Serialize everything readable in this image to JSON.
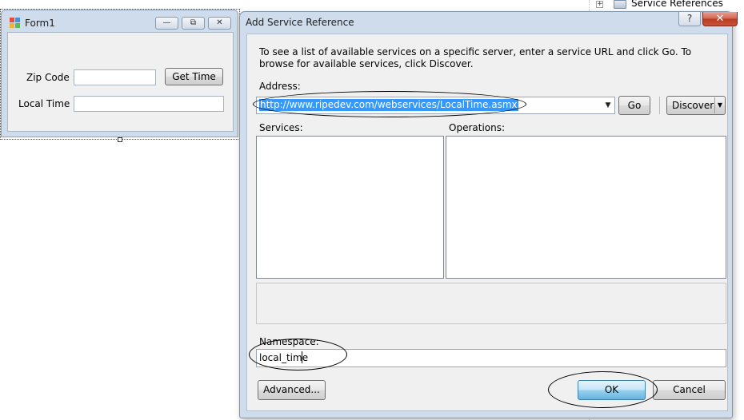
{
  "solution_explorer": {
    "node_label": "Service References",
    "expander": "+"
  },
  "form1": {
    "title": "Form1",
    "zip_label": "Zip Code :",
    "zip_value": "",
    "get_time_label": "Get Time",
    "local_time_label": "Local Time :",
    "local_time_value": "",
    "caption_buttons": [
      "minimize-icon",
      "restore-icon",
      "close-icon"
    ]
  },
  "dialog": {
    "title": "Add Service Reference",
    "help_glyph": "?",
    "close_glyph": "✕",
    "instructions": "To see a list of available services on a specific server, enter a service URL and click Go. To browse for available services, click Discover.",
    "address_label": "Address:",
    "address_value": "http://www.ripedev.com/webservices/LocalTime.asmx",
    "go_label": "Go",
    "discover_label": "Discover",
    "services_label": "Services:",
    "operations_label": "Operations:",
    "namespace_label": "Namespace:",
    "namespace_value": "local_time",
    "advanced_label": "Advanced...",
    "ok_label": "OK",
    "cancel_label": "Cancel"
  },
  "colors": {
    "selection": "#3399ff",
    "window_frame": "#cfdceb",
    "dialog_surface": "#f0f0f0",
    "close_button": "#c9543a",
    "ok_button": "#98d1ef"
  }
}
